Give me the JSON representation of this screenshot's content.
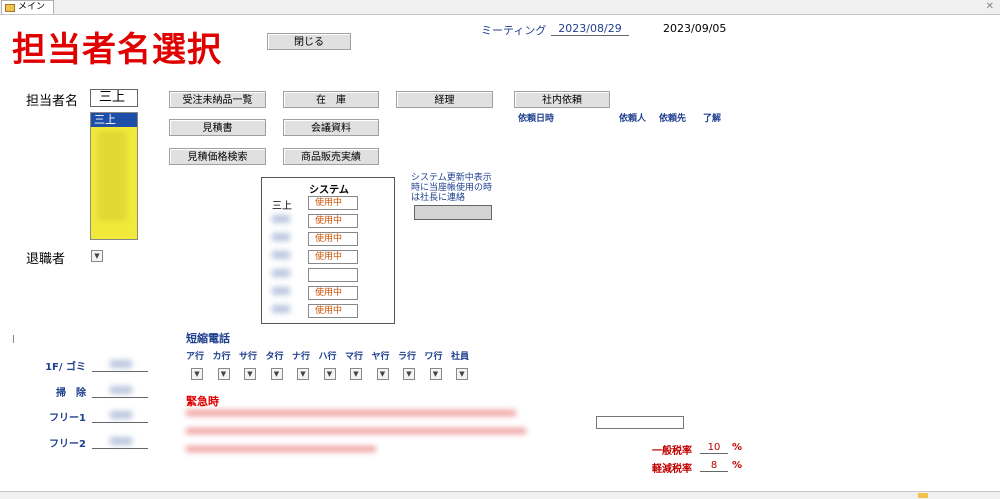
{
  "tab": {
    "label": "メイン"
  },
  "page_title": "担当者名選択",
  "close_button": "閉じる",
  "meeting": {
    "label": "ミーティング",
    "date1": "2023/08/29",
    "date2": "2023/09/05"
  },
  "tanto": {
    "label": "担当者名",
    "value": "三上",
    "list_selected": "三上"
  },
  "retired_label": "退職者",
  "buttons": {
    "order": "受注未納品一覧",
    "stock": "在　庫",
    "accounting": "経理",
    "internal_request": "社内依頼",
    "estimate": "見積書",
    "meeting_docs": "会議資料",
    "estimate_price_search": "見積価格検索",
    "product_sales": "商品販売実績"
  },
  "request_headers": {
    "date": "依頼日時",
    "requester": "依頼人",
    "to": "依頼先",
    "ok": "了解"
  },
  "system": {
    "title": "システム",
    "rows": [
      {
        "name": "三上",
        "status": "使用中"
      },
      {
        "name": "",
        "status": "使用中"
      },
      {
        "name": "",
        "status": "使用中"
      },
      {
        "name": "",
        "status": "使用中"
      },
      {
        "name": "",
        "status": ""
      },
      {
        "name": "",
        "status": "使用中"
      },
      {
        "name": "",
        "status": "使用中"
      }
    ]
  },
  "system_notice": "システム更新中表示時に当座帳使用の時は社長に連絡",
  "duty": {
    "rows": [
      {
        "label": "1F/ ゴミ"
      },
      {
        "label": "掃　除"
      },
      {
        "label": "フリー1"
      },
      {
        "label": "フリー2"
      }
    ]
  },
  "short_dial": {
    "title": "短縮電話",
    "groups": [
      "ア行",
      "カ行",
      "サ行",
      "タ行",
      "ナ行",
      "ハ行",
      "マ行",
      "ヤ行",
      "ラ行",
      "ワ行",
      "社員"
    ]
  },
  "emergency_label": "緊急時",
  "tax": {
    "general_label": "一般税率",
    "general_value": "10",
    "general_unit": "%",
    "reduced_label": "軽減税率",
    "reduced_value": "8",
    "reduced_unit": "%"
  }
}
